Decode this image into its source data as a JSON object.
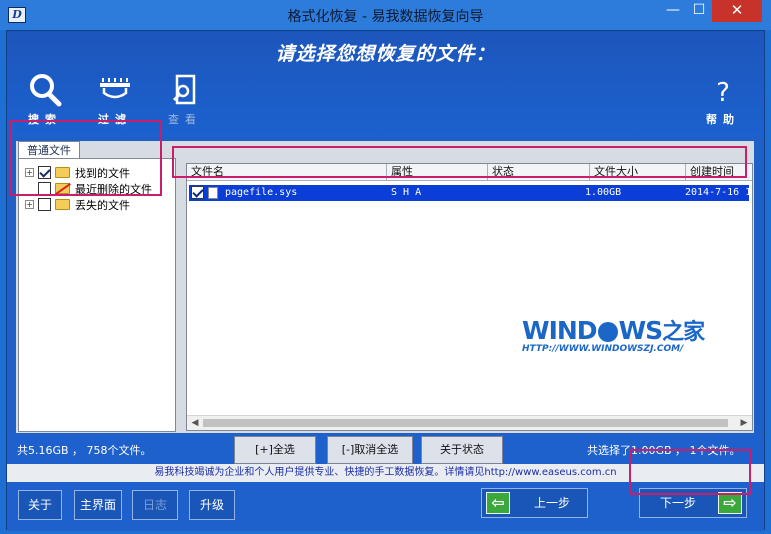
{
  "window": {
    "app_icon": "D",
    "title": "格式化恢复 - 易我数据恢复向导",
    "min_label": "—",
    "max_label": "☐",
    "close_label": "✕"
  },
  "header": {
    "heading": "请选择您想恢复的文件："
  },
  "toolbar": {
    "search_label": "搜索",
    "filter_label": "过滤",
    "view_label": "查看",
    "help_label": "帮助"
  },
  "tree": {
    "tab_label": "普通文件",
    "items": [
      {
        "label": "找到的文件",
        "checked": true,
        "icon": "folder-icon"
      },
      {
        "label": "最近删除的文件",
        "checked": false,
        "icon": "deleted-folder-icon"
      },
      {
        "label": "丢失的文件",
        "checked": false,
        "icon": "folder-icon"
      }
    ]
  },
  "list": {
    "columns": [
      "文件名",
      "属性",
      "状态",
      "文件大小",
      "创建时间"
    ],
    "rows": [
      {
        "name": "pagefile.sys",
        "attributes": "S H A",
        "status": "",
        "size": "1.00GB",
        "created": "2014-7-16 1",
        "checked": true
      }
    ]
  },
  "watermark": {
    "logo_main": "WIND",
    "logo_mid": "WS",
    "logo_cn": "之家",
    "url": "HTTP://WWW.WINDOWSZJ.COM/"
  },
  "status": {
    "total": "共5.16GB ， 758个文件。",
    "selected": "共选择了1.00GB ， 1个文件。",
    "select_all": "[+]全选",
    "deselect_all": "[-]取消全选",
    "about_status": "关于状态"
  },
  "info": {
    "text": "易我科技竭诚为企业和个人用户提供专业、快捷的手工数据恢复。详情请见http://www.easeus.com.cn"
  },
  "bottom": {
    "about": "关于",
    "home": "主界面",
    "log": "日志",
    "upgrade": "升级",
    "prev": "上一步",
    "next": "下一步",
    "prev_arrow": "⇦",
    "next_arrow": "⇨"
  },
  "colors": {
    "accent": "#1e60cc",
    "highlight": "#c81e6b",
    "selection": "#0a3ed6"
  }
}
